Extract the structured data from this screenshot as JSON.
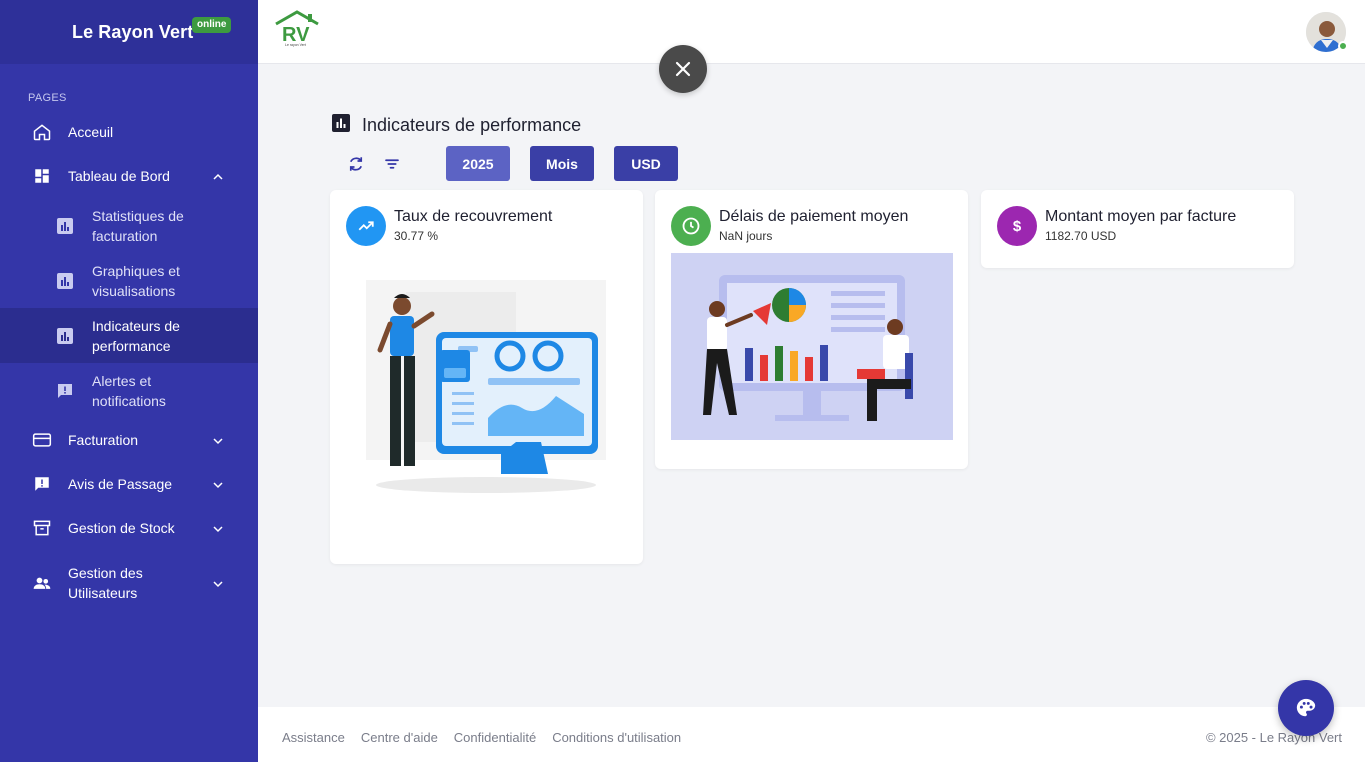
{
  "sidebar": {
    "brand": "Le Rayon Vert",
    "status_badge": "online",
    "section_label": "PAGES",
    "items": [
      {
        "label": "Acceuil",
        "icon": "home-icon"
      },
      {
        "label": "Tableau de Bord",
        "icon": "dashboard-icon",
        "expanded": true
      },
      {
        "label": "Facturation",
        "icon": "credit-card-icon"
      },
      {
        "label": "Avis de Passage",
        "icon": "feedback-icon"
      },
      {
        "label": "Gestion de Stock",
        "icon": "archive-icon"
      },
      {
        "label": "Gestion des Utilisateurs",
        "icon": "people-icon"
      }
    ],
    "sub_items": [
      {
        "label": "Statistiques de facturation",
        "icon": "bar-chart-icon"
      },
      {
        "label": "Graphiques et visualisations",
        "icon": "bar-chart-icon"
      },
      {
        "label": "Indicateurs de performance",
        "icon": "bar-chart-icon",
        "active": true
      },
      {
        "label": "Alertes et notifications",
        "icon": "alert-message-icon"
      }
    ]
  },
  "topbar": {
    "logo_text": "RV",
    "logo_caption": "Le rayon Vert"
  },
  "main": {
    "title": "Indicateurs de performance",
    "filters": {
      "year": "2025",
      "period": "Mois",
      "currency": "USD"
    },
    "cards": [
      {
        "title": "Taux de recouvrement",
        "value": "30.77 %",
        "icon": "trending-up-icon",
        "color": "#2196f3"
      },
      {
        "title": "Délais de paiement moyen",
        "value": "NaN jours",
        "icon": "clock-icon",
        "color": "#4caf50"
      },
      {
        "title": "Montant moyen par facture",
        "value": "1182.70 USD",
        "icon": "dollar-icon",
        "color": "#9c27b0"
      }
    ]
  },
  "footer": {
    "links": [
      "Assistance",
      "Centre d'aide",
      "Confidentialité",
      "Conditions d'utilisation"
    ],
    "copyright": "© 2025 - Le Rayon Vert"
  },
  "colors": {
    "sidebar": "#3436a8",
    "active_item": "#2b2d8f",
    "pill_year": "#5c63c4",
    "pill": "#3a3fa6",
    "online": "#3d9a40"
  }
}
